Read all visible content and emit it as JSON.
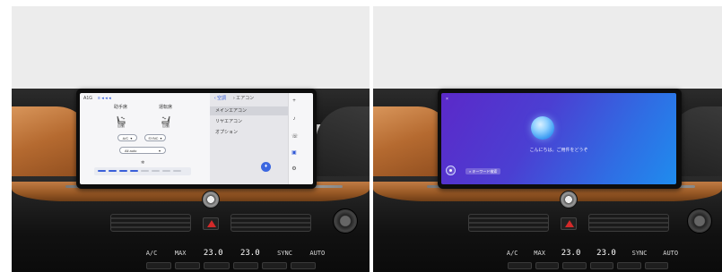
{
  "left_screen": {
    "header_code": "A1G",
    "header_icons": "≡ ◂ ◂ ◂",
    "seat_driver_label": "助手席",
    "seat_passenger_label": "運転席",
    "seat_driver_status": "自動",
    "seat_passenger_status": "自動",
    "auto_button": "A/C",
    "sync_button": "SYNC",
    "mode_select": "All auto",
    "fan_level": 4,
    "fan_segments": 8,
    "menu_breadcrumb_back": "空調",
    "menu_breadcrumb_current": "エアコン",
    "menu_items": [
      "メインエアコン",
      "リヤエアコン",
      "オプション"
    ],
    "menu_active_index": 0,
    "rail_icons": [
      "plus-icon",
      "music-icon",
      "phone-icon",
      "car-icon",
      "settings-icon"
    ],
    "fab_label": "♦"
  },
  "right_screen": {
    "close_label": "×",
    "greeting": "こんにちは。ご用件をどうぞ",
    "chip_label": "キーワード検索"
  },
  "console": {
    "left_temp": "23.0",
    "right_temp": "23.0",
    "labels": [
      "A/C",
      "MAX",
      "SYNC",
      "AUTO"
    ]
  }
}
